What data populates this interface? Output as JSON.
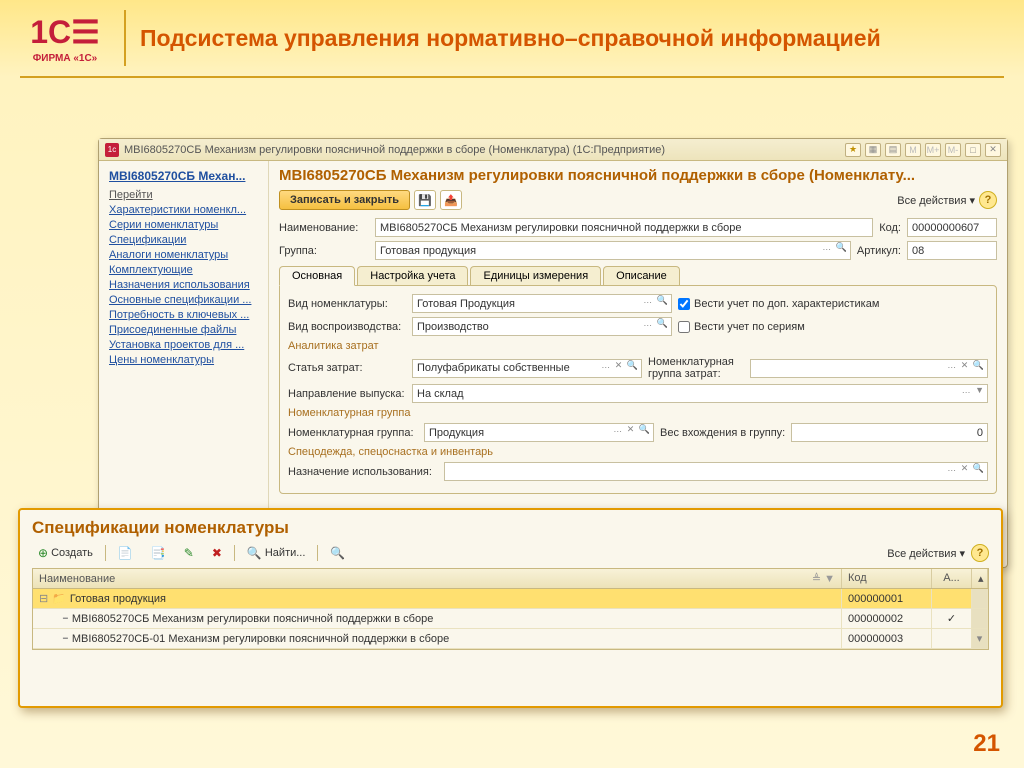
{
  "slide": {
    "logo_text": "1C",
    "logo_symbol": "☰",
    "logo_sub": "ФИРМА «1С»",
    "title": "Подсистема управления нормативно–справочной информацией",
    "page_number": "21"
  },
  "window": {
    "title": "MBI6805270СБ Механизм регулировки поясничной поддержки в сборе (Номенклатура) (1С:Предприятие)",
    "sidebar": {
      "title": "MBI6805270СБ Механ...",
      "section": "Перейти",
      "links": [
        "Характеристики номенкл...",
        "Серии номенклатуры",
        "Спецификации",
        "Аналоги номенклатуры",
        "Комплектующие",
        "Назначения использования",
        "Основные спецификации ...",
        "Потребность в ключевых ...",
        "Присоединенные файлы",
        "Установка проектов для ...",
        "Цены номенклатуры"
      ]
    },
    "content": {
      "title": "MBI6805270СБ Механизм регулировки поясничной поддержки в сборе (Номенклату...",
      "save_close": "Записать и закрыть",
      "all_actions": "Все действия ▾",
      "labels": {
        "name": "Наименование:",
        "group": "Группа:",
        "code": "Код:",
        "article": "Артикул:",
        "nom_type": "Вид номенклатуры:",
        "repro_type": "Вид воспроизводства:",
        "cost_analytics": "Аналитика затрат",
        "cost_item": "Статья затрат:",
        "nom_cost_group": "Номенклатурная группа затрат:",
        "output_dir": "Направление выпуска:",
        "nom_group_sec": "Номенклатурная группа",
        "nom_group": "Номенклатурная группа:",
        "weight_in_group": "Вес вхождения в группу:",
        "special_sec": "Спецодежда, спецоснастка и инвентарь",
        "usage_purpose": "Назначение использования:",
        "check_extra": "Вести учет по доп. характеристикам",
        "check_series": "Вести учет по сериям"
      },
      "values": {
        "name": "MBI6805270СБ Механизм регулировки поясничной поддержки в сборе",
        "group": "Готовая продукция",
        "code": "00000000607",
        "article": "08",
        "nom_type": "Готовая Продукция",
        "repro_type": "Производство",
        "cost_item": "Полуфабрикаты собственные",
        "nom_cost_group": "",
        "output_dir": "На склад",
        "nom_group": "Продукция",
        "weight_in_group": "0",
        "usage_purpose": ""
      },
      "tabs": [
        "Основная",
        "Настройка учета",
        "Единицы измерения",
        "Описание"
      ]
    }
  },
  "spec": {
    "title": "Спецификации номенклатуры",
    "toolbar": {
      "create": "Создать",
      "find": "Найти...",
      "all_actions": "Все действия ▾"
    },
    "columns": {
      "name": "Наименование",
      "code": "Код",
      "a": "А..."
    },
    "rows": [
      {
        "type": "folder",
        "name": "Готовая продукция",
        "code": "000000001",
        "a": "",
        "selected": true
      },
      {
        "type": "item",
        "indent": 1,
        "name": "MBI6805270СБ Механизм регулировки поясничной поддержки в сборе",
        "code": "000000002",
        "a": "✓"
      },
      {
        "type": "item",
        "indent": 1,
        "name": "MBI6805270СБ-01 Механизм регулировки поясничной поддержки в сборе",
        "code": "000000003",
        "a": ""
      }
    ]
  }
}
